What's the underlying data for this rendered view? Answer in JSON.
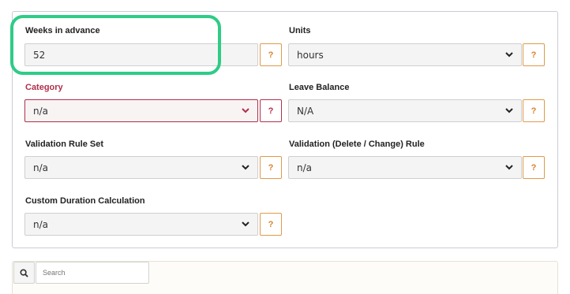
{
  "form": {
    "weeks_in_advance": {
      "label": "Weeks in advance",
      "value": "52"
    },
    "units": {
      "label": "Units",
      "value": "hours"
    },
    "category": {
      "label": "Category",
      "value": "n/a"
    },
    "leave_balance": {
      "label": "Leave Balance",
      "value": "N/A"
    },
    "validation_rule_set": {
      "label": "Validation Rule Set",
      "value": "n/a"
    },
    "validation_delete_change_rule": {
      "label": "Validation (Delete / Change) Rule",
      "value": "n/a"
    },
    "custom_duration_calculation": {
      "label": "Custom Duration Calculation",
      "value": "n/a"
    },
    "help_label": "?"
  },
  "search": {
    "placeholder": "Search"
  },
  "colors": {
    "highlight": "#2ecc87",
    "help_accent": "#d9822b",
    "error": "#b0304a"
  },
  "icons": {
    "dropdown": "chevron-down-icon",
    "search": "search-icon"
  }
}
